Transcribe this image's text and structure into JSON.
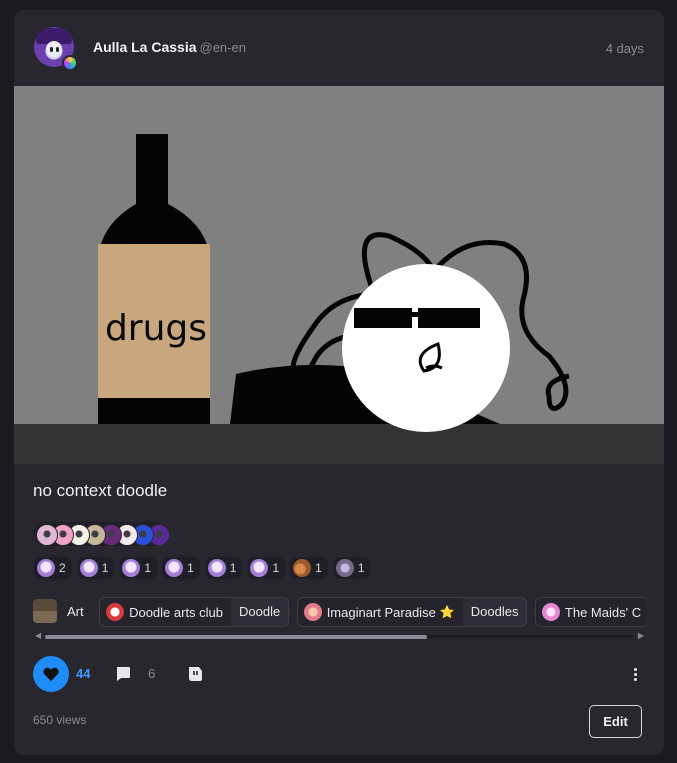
{
  "post": {
    "author": "Aulla La Cassia",
    "handle": "@en-en",
    "time": "4 days",
    "image_text": "drugs",
    "title": "no context doodle"
  },
  "reactors": [
    {
      "color": "#e2b8d8"
    },
    {
      "color": "#f0a3c6"
    },
    {
      "color": "#f3f0e8"
    },
    {
      "color": "#c7b79a"
    },
    {
      "color": "#6a2a7a"
    },
    {
      "color": "#f2e9ef"
    },
    {
      "color": "#2950d8"
    },
    {
      "color": "#5a2a9a"
    }
  ],
  "reactions": [
    {
      "count": "2",
      "icon": "ghost-emoji-icon"
    },
    {
      "count": "1",
      "icon": "ghost-emoji-icon"
    },
    {
      "count": "1",
      "icon": "ghost-emoji-icon"
    },
    {
      "count": "1",
      "icon": "ghost-emoji-icon"
    },
    {
      "count": "1",
      "icon": "ghost-emoji-icon"
    },
    {
      "count": "1",
      "icon": "ghost-emoji-icon"
    },
    {
      "count": "1",
      "icon": "squirrel-emoji-icon"
    },
    {
      "count": "1",
      "icon": "mixed-emoji-icon"
    }
  ],
  "tags": {
    "art": "Art",
    "community1": "Doodle arts club",
    "community1_sub": "Doodle",
    "community2": "Imaginart Paradise",
    "community2_star": "⭐",
    "community2_sub": "Doodles",
    "community3": "The Maids' C"
  },
  "actions": {
    "likes": "44",
    "comments": "6"
  },
  "footer": {
    "views": "650 views",
    "edit_label": "Edit"
  },
  "colors": {
    "accent": "#1f8cf7",
    "card_bg": "#28262f",
    "page_bg": "#1b1a20"
  }
}
